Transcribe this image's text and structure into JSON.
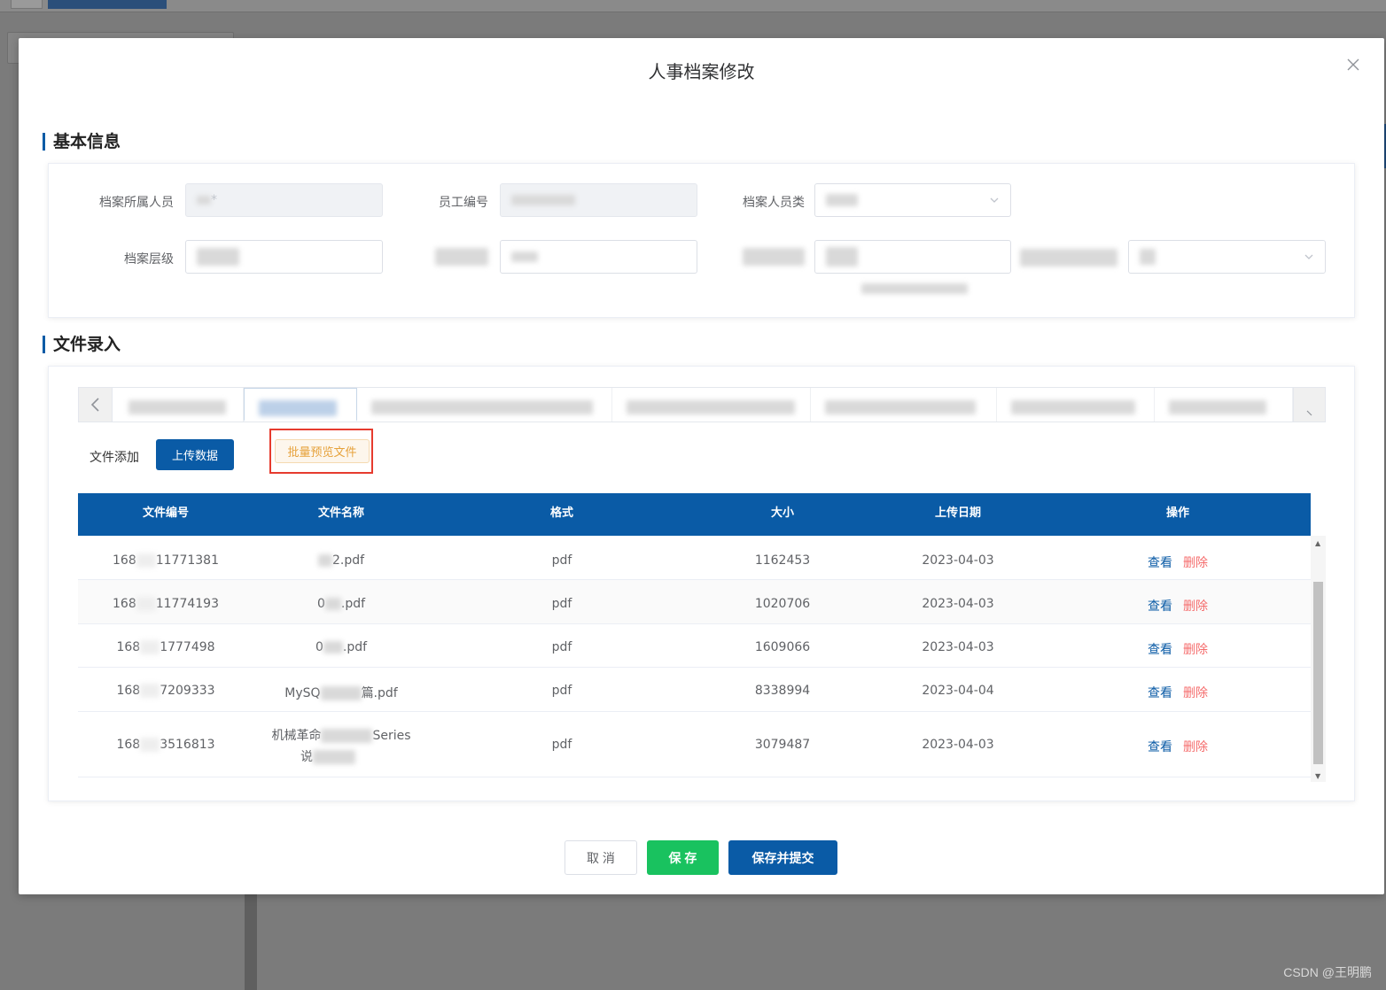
{
  "dialog": {
    "title": "人事档案修改"
  },
  "basic_info": {
    "section_title": "基本信息",
    "fields": {
      "owner_label": "档案所属人员",
      "owner_value": "*",
      "employee_no_label": "员工编号",
      "category_label": "档案人员类",
      "level_label": "档案层级"
    }
  },
  "file_entry": {
    "section_title": "文件录入",
    "add_label": "文件添加",
    "upload_button": "上传数据",
    "batch_preview_button": "批量预览文件",
    "table": {
      "columns": [
        "文件编号",
        "文件名称",
        "格式",
        "大小",
        "上传日期",
        "操作"
      ],
      "rows": [
        {
          "id_prefix": "168",
          "id_suffix": "11771381",
          "name_prefix": "",
          "name_suffix": "2.pdf",
          "format": "pdf",
          "size": "1162453",
          "date": "2023-04-03"
        },
        {
          "id_prefix": "168",
          "id_suffix": "11774193",
          "name_prefix": "0",
          "name_suffix": ".pdf",
          "format": "pdf",
          "size": "1020706",
          "date": "2023-04-03"
        },
        {
          "id_prefix": "168",
          "id_suffix": "1777498",
          "name_prefix": "0",
          "name_suffix": ".pdf",
          "format": "pdf",
          "size": "1609066",
          "date": "2023-04-03"
        },
        {
          "id_prefix": "168",
          "id_suffix": "7209333",
          "name_prefix": "MySQ",
          "name_suffix": "篇.pdf",
          "format": "pdf",
          "size": "8338994",
          "date": "2023-04-04"
        },
        {
          "id_prefix": "168",
          "id_suffix": "3516813",
          "name_prefix": "机械革命",
          "name_suffix": "Series",
          "name_line2": "说",
          "format": "pdf",
          "size": "3079487",
          "date": "2023-04-03"
        }
      ],
      "view_label": "查看",
      "delete_label": "删除"
    }
  },
  "footer": {
    "cancel": "取 消",
    "save": "保 存",
    "save_submit": "保存并提交"
  },
  "watermark": "CSDN @王明鹏",
  "colors": {
    "primary": "#0a5ba6",
    "success": "#19c25f",
    "danger": "#f56c6c",
    "warning": "#e6a23c",
    "highlight_border": "#e63b2e"
  }
}
